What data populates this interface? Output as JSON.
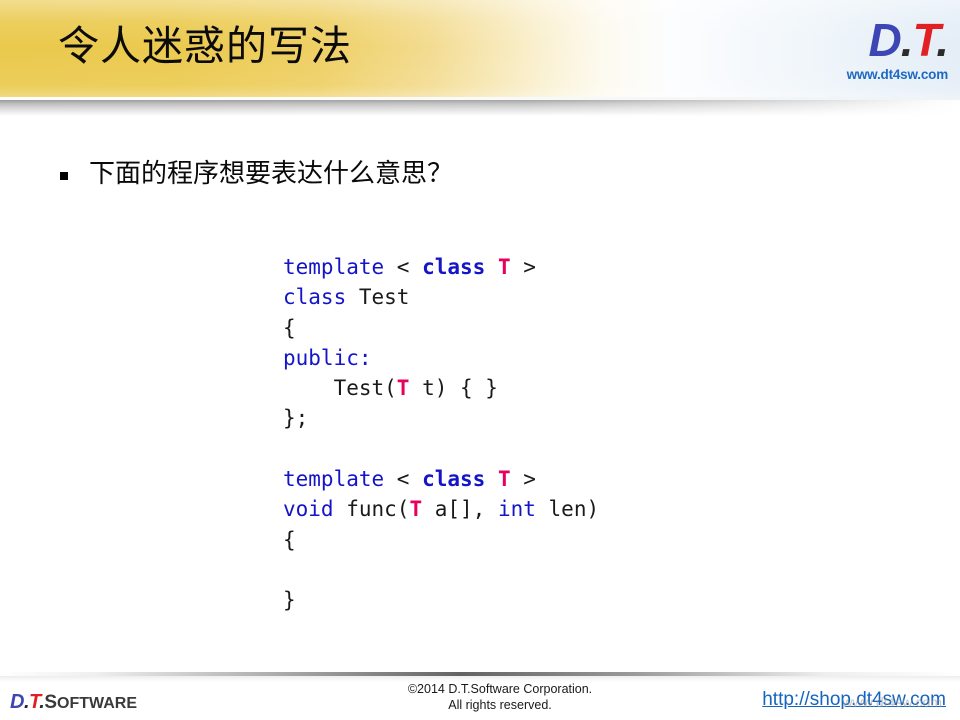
{
  "header": {
    "title": "令人迷惑的写法",
    "logo": {
      "d": "D",
      "dot1": ".",
      "t": "T",
      "dot2": ".",
      "url": "www.dt4sw.com"
    },
    "colors": {
      "band_gold": "#eac94c",
      "band_end": "#e4eef7",
      "logo_blue": "#3d46b4",
      "logo_red": "#e21f22",
      "url_blue": "#1f68c4"
    }
  },
  "body": {
    "bullet": {
      "marker": "square-bullet",
      "text": "下面的程序想要表达什么意思？"
    },
    "code": {
      "language": "cpp",
      "colors": {
        "keyword_blue": "#1414c8",
        "type_param_pink": "#e8005e",
        "plain": "#1a1a1a"
      },
      "lines": [
        [
          {
            "t": "template",
            "c": "kw"
          },
          {
            "t": " < ",
            "c": "pl"
          },
          {
            "t": "class",
            "c": "kwb"
          },
          {
            "t": " ",
            "c": "pl"
          },
          {
            "t": "T",
            "c": "tp"
          },
          {
            "t": " >",
            "c": "pl"
          }
        ],
        [
          {
            "t": "class",
            "c": "kw"
          },
          {
            "t": " Test",
            "c": "pl"
          }
        ],
        [
          {
            "t": "{",
            "c": "pl"
          }
        ],
        [
          {
            "t": "public",
            "c": "kw"
          },
          {
            "t": ":",
            "c": "kw"
          }
        ],
        [
          {
            "t": "    Test(",
            "c": "pl"
          },
          {
            "t": "T",
            "c": "tp"
          },
          {
            "t": " t) { }",
            "c": "pl"
          }
        ],
        [
          {
            "t": "};",
            "c": "pl"
          }
        ],
        [
          {
            "t": " ",
            "c": "pl"
          }
        ],
        [
          {
            "t": "template",
            "c": "kw"
          },
          {
            "t": " < ",
            "c": "pl"
          },
          {
            "t": "class",
            "c": "kwb"
          },
          {
            "t": " ",
            "c": "pl"
          },
          {
            "t": "T",
            "c": "tp"
          },
          {
            "t": " >",
            "c": "pl"
          }
        ],
        [
          {
            "t": "void",
            "c": "kw"
          },
          {
            "t": " func(",
            "c": "pl"
          },
          {
            "t": "T",
            "c": "tp"
          },
          {
            "t": " a[], ",
            "c": "pl"
          },
          {
            "t": "int",
            "c": "kw"
          },
          {
            "t": " len)",
            "c": "pl"
          }
        ],
        [
          {
            "t": "{",
            "c": "pl"
          }
        ],
        [
          {
            "t": " ",
            "c": "pl"
          }
        ],
        [
          {
            "t": "}",
            "c": "pl"
          }
        ]
      ],
      "plain_text": "template < class T >\nclass Test\n{\npublic:\n    Test(T t) { }\n};\n\ntemplate < class T >\nvoid func(T a[], int len)\n{\n\n}"
    }
  },
  "footer": {
    "logo": {
      "d": "D",
      "dot1": ".",
      "t": "T",
      "dot2": ".",
      "software_cap": "S",
      "software_rest": "OFTWARE"
    },
    "copyright_line1": "©2014 D.T.Software Corporation.",
    "copyright_line2": "All rights reserved.",
    "shop_link": "http://shop.dt4sw.com"
  }
}
